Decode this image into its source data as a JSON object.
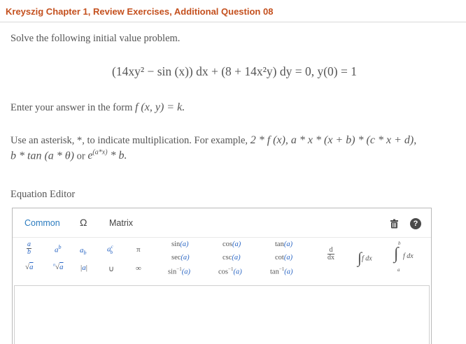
{
  "header": {
    "title": "Kreyszig Chapter 1, Review Exercises, Additional Question 08"
  },
  "problem": {
    "intro": "Solve the following initial value problem.",
    "equation": "(14xy² − sin (x)) dx + (8 + 14x²y) dy = 0, y(0) = 1",
    "form_prefix": "Enter your answer in the form",
    "form_math": "f (x, y) = k.",
    "asterisk_line1_prefix": "Use an asterisk, *, to indicate multiplication. For example,",
    "asterisk_line1_math": "2 * f (x), a * x * (x + b) * (c * x + d),",
    "asterisk_line2_math1": "b * tan (a * θ)",
    "asterisk_line2_or": "or",
    "asterisk_line2_math2": "e",
    "asterisk_line2_sup": "(a*x)",
    "asterisk_line2_math3": "* b."
  },
  "editor": {
    "heading": "Equation Editor",
    "tabs": {
      "common": "Common",
      "symbols": "Ω",
      "matrix": "Matrix"
    },
    "help_label": "?",
    "palette": {
      "sym_pi": "π",
      "sym_union": "∪",
      "sym_infinity": "∞",
      "trig": {
        "sin": "sin",
        "cos": "cos",
        "tan": "tan",
        "sec": "sec",
        "csc": "csc",
        "cot": "cot",
        "asin": "sin",
        "acos": "cos",
        "atan": "tan",
        "arg": "(a)",
        "inv": "−1"
      },
      "deriv_d": "d",
      "deriv_dx": "dx",
      "integral_text": "f dx",
      "def_int_upper": "b",
      "def_int_lower": "a"
    }
  }
}
